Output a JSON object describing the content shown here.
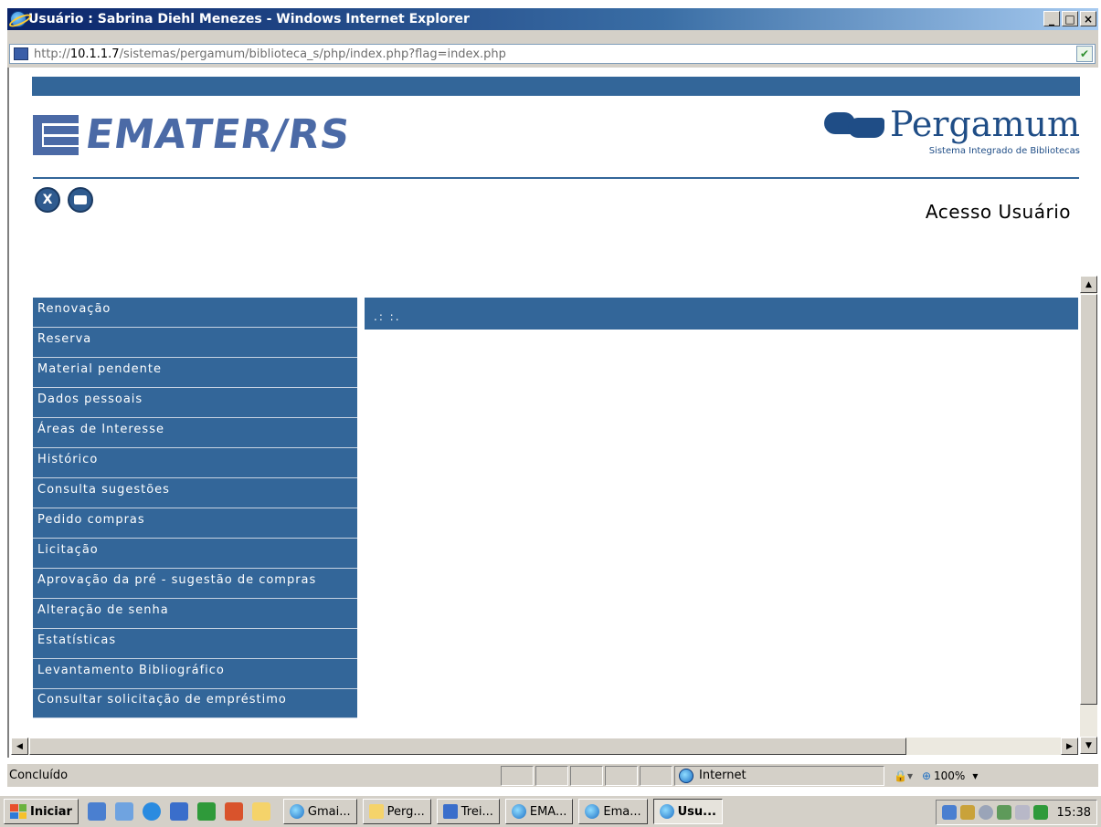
{
  "window": {
    "title": "Usuário : Sabrina Diehl Menezes - Windows Internet Explorer",
    "minimize": "_",
    "restore": "□",
    "close": "×"
  },
  "address": {
    "url_prefix": "http://",
    "url_host": "10.1.1.7",
    "url_path": "/sistemas/pergamum/biblioteca_s/php/index.php?flag=index.php"
  },
  "page": {
    "brand": "EMATER/RS",
    "pergamum_name": "Pergamum",
    "pergamum_subtitle": "Sistema Integrado de Bibliotecas",
    "access_title": "Acesso Usuário",
    "close_icon_label": "X",
    "content_header": ".: :.",
    "menu": [
      "Renovação",
      "Reserva",
      "Material pendente",
      "Dados pessoais",
      "Áreas de Interesse",
      "Histórico",
      "Consulta sugestões",
      "Pedido compras",
      "Licitação",
      "Aprovação da pré - sugestão de compras",
      "Alteração de senha",
      "Estatísticas",
      "Levantamento Bibliográfico",
      "Consultar solicitação de empréstimo"
    ]
  },
  "status": {
    "text": "Concluído",
    "zone": "Internet",
    "zoom": "100%"
  },
  "taskbar": {
    "start": "Iniciar",
    "tasks": [
      "Gmai...",
      "Perg...",
      "Trei...",
      "EMA...",
      "Ema...",
      "Usu..."
    ],
    "clock": "15:38"
  },
  "colors": {
    "accent": "#336699",
    "title_bar": "#0a246a",
    "chrome": "#d4d0c8"
  }
}
